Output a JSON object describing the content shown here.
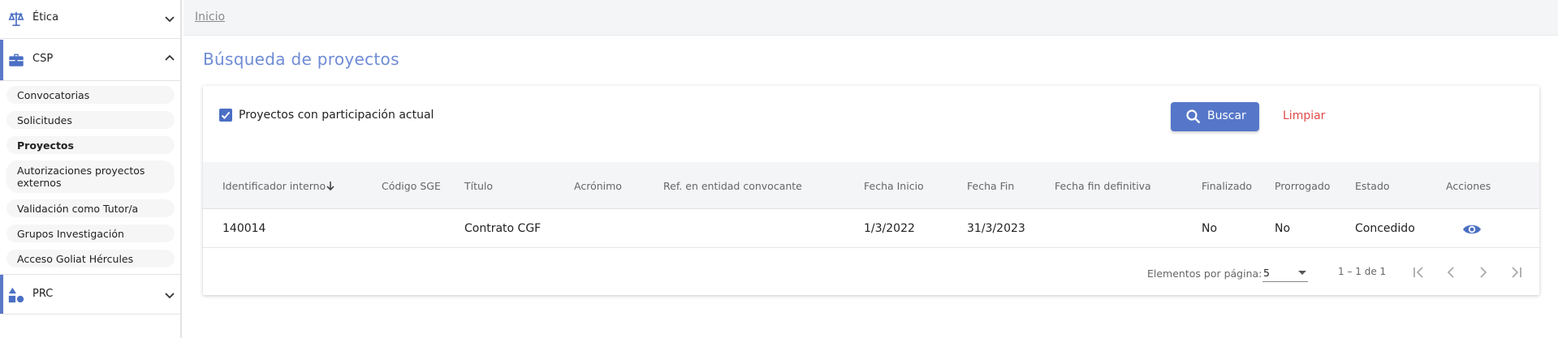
{
  "sidebar": {
    "sections": [
      {
        "label": "Ética",
        "icon": "scale-icon",
        "expanded": false
      },
      {
        "label": "CSP",
        "icon": "briefcase-icon",
        "expanded": true
      },
      {
        "label": "PRC",
        "icon": "shapes-icon",
        "expanded": false
      }
    ],
    "csp_items": [
      {
        "label": "Convocatorias"
      },
      {
        "label": "Solicitudes"
      },
      {
        "label": "Proyectos",
        "active": true
      },
      {
        "label": "Autorizaciones proyectos externos"
      },
      {
        "label": "Validación como Tutor/a"
      },
      {
        "label": "Grupos Investigación"
      },
      {
        "label": "Acceso Goliat Hércules"
      }
    ]
  },
  "breadcrumb": {
    "home": "Inicio"
  },
  "page": {
    "title": "Búsqueda de proyectos"
  },
  "filters": {
    "checkbox_label": "Proyectos con participación actual",
    "checkbox_checked": true,
    "search_label": "Buscar",
    "clear_label": "Limpiar"
  },
  "table": {
    "columns": [
      "Identificador interno",
      "Código SGE",
      "Título",
      "Acrónimo",
      "Ref. en entidad convocante",
      "Fecha Inicio",
      "Fecha Fin",
      "Fecha fin definitiva",
      "Finalizado",
      "Prorrogado",
      "Estado",
      "Acciones"
    ],
    "rows": [
      [
        "140014",
        "",
        "Contrato CGF",
        "",
        "",
        "1/3/2022",
        "31/3/2023",
        "",
        "No",
        "No",
        "Concedido",
        "view-icon"
      ]
    ]
  },
  "paginator": {
    "items_per_page_label": "Elementos por página:",
    "page_size": "5",
    "range": "1 – 1 de 1"
  },
  "colors": {
    "accent": "#5677c9",
    "title": "#6e8cd4",
    "danger": "#e04a4a"
  }
}
